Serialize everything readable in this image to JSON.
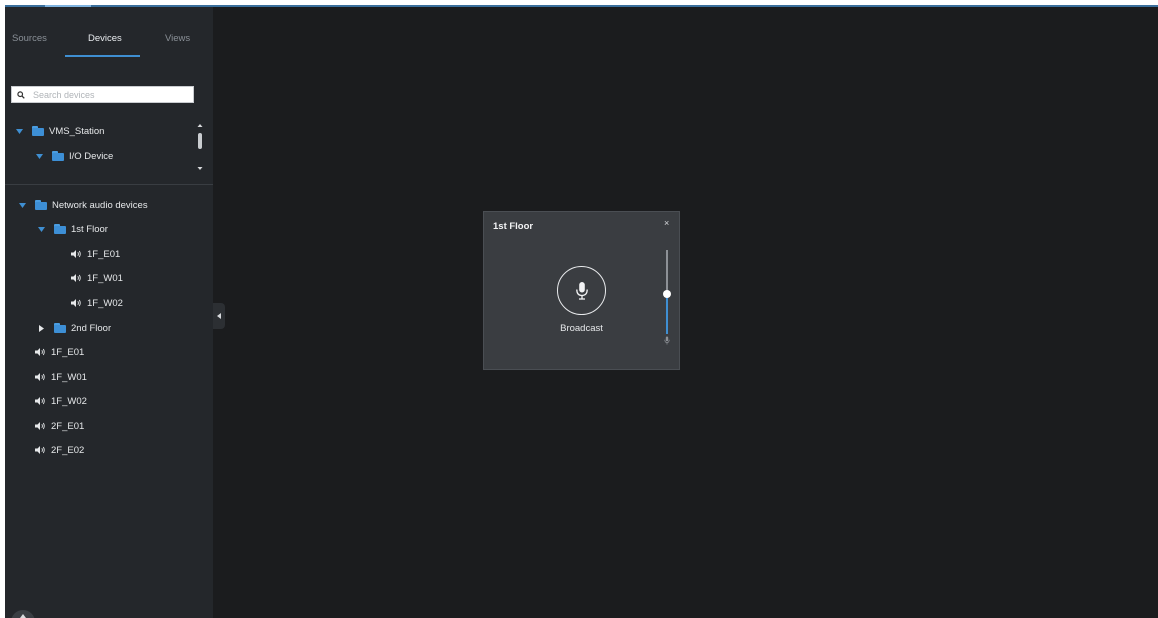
{
  "sidebar": {
    "tabs": [
      {
        "label": "Sources"
      },
      {
        "label": "Devices",
        "active": true
      },
      {
        "label": "Views"
      }
    ],
    "search": {
      "placeholder": "Search devices",
      "value": ""
    },
    "tree": {
      "station": {
        "label": "VMS_Station",
        "expanded": true
      },
      "io_device": {
        "label": "I/O Device",
        "expanded": true
      },
      "network_audio": {
        "label": "Network audio devices",
        "expanded": true
      },
      "floor1": {
        "label": "1st Floor",
        "expanded": true
      },
      "floor1_devices": [
        "1F_E01",
        "1F_W01",
        "1F_W02"
      ],
      "floor2": {
        "label": "2nd Floor",
        "expanded": false
      },
      "devices": [
        "1F_E01",
        "1F_W01",
        "1F_W02",
        "2F_E01",
        "2F_E02"
      ]
    }
  },
  "panel": {
    "title": "1st Floor",
    "close": "×",
    "broadcast_label": "Broadcast",
    "volume_level": 0.48
  },
  "colors": {
    "accent": "#3f8fd2",
    "folder": "#3d8fd6",
    "background": "#1b1c1e",
    "sidebar": "#24272b",
    "panel": "#3a3d41"
  },
  "icons": [
    "search-icon",
    "folder-icon",
    "speaker-icon",
    "microphone-icon",
    "triangle-down-icon",
    "triangle-right-icon"
  ]
}
